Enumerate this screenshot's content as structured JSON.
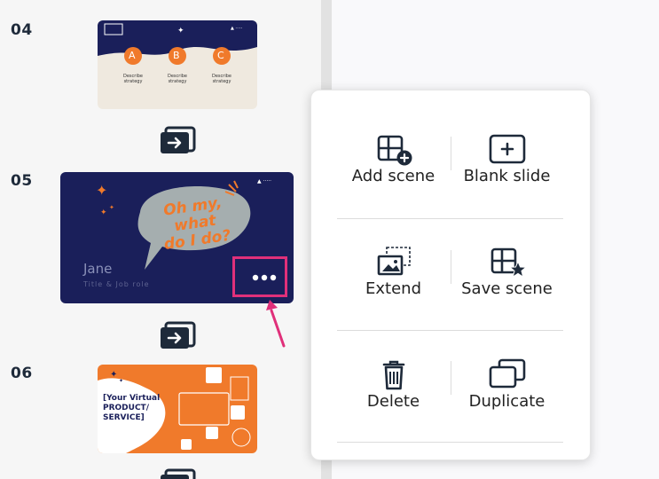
{
  "scenes": [
    {
      "number": "04",
      "card_labels": [
        "A",
        "B",
        "C"
      ],
      "card_text": "Describe strategy"
    },
    {
      "number": "05",
      "bubble_text": [
        "Oh my,",
        "what",
        "do I do?"
      ],
      "name": "Jane",
      "subtitle": "Title & Job role"
    },
    {
      "number": "06",
      "product_text": [
        "[Your Virtual",
        "PRODUCT/",
        "SERVICE]"
      ]
    }
  ],
  "context_menu": {
    "add_scene": "Add scene",
    "blank_slide": "Blank slide",
    "extend": "Extend",
    "save_scene": "Save scene",
    "delete": "Delete",
    "duplicate": "Duplicate"
  },
  "icons": {
    "more": "more-horizontal-icon",
    "transition": "transition-icon",
    "pointer": "arrow-pointer-icon"
  },
  "colors": {
    "accent_orange": "#f07a2b",
    "navy": "#1a1f5a",
    "highlight": "#e0307a"
  }
}
